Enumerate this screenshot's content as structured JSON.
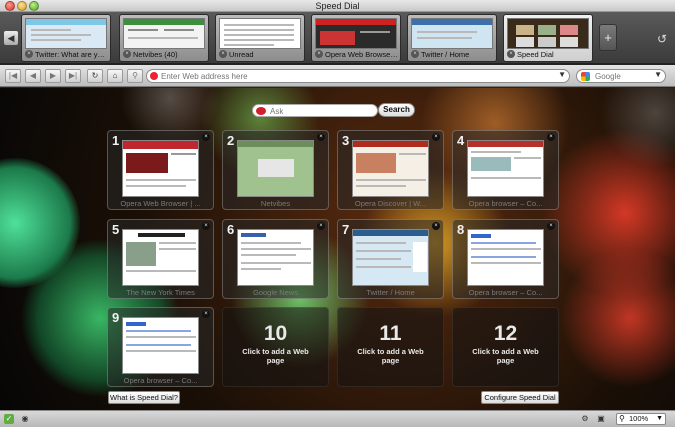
{
  "window": {
    "title": "Speed Dial"
  },
  "tabs": [
    {
      "label": "Twitter: What are you do...",
      "thumb": "#dbe9f4",
      "accent": "#7fc7e6",
      "active": false
    },
    {
      "label": "Netvibes (40)",
      "thumb": "#f3f3f3",
      "accent": "#3d8f3d",
      "active": false
    },
    {
      "label": "Unread",
      "thumb": "#ffffff",
      "accent": "#cccccc",
      "active": false
    },
    {
      "label": "Opera Web Browser | Fa...",
      "thumb": "#2b2b2b",
      "accent": "#cc2222",
      "active": false
    },
    {
      "label": "Twitter / Home",
      "thumb": "#cfe6f2",
      "accent": "#3d6fa8",
      "active": false
    },
    {
      "label": "Speed Dial",
      "thumb": "#3a2a1a",
      "accent": "#e06a20",
      "active": true
    }
  ],
  "toolbar": {
    "address_placeholder": "Enter Web address here",
    "search_placeholder": "Google"
  },
  "speeddial": {
    "ask_placeholder": "Ask",
    "search_button": "Search",
    "what_is_button": "What is Speed Dial?",
    "configure_button": "Configure Speed Dial",
    "dials": [
      {
        "number": "1",
        "label": "Opera Web Browser | ...",
        "thumb": "#ffffff",
        "accent": "#c0262d"
      },
      {
        "number": "2",
        "label": "Netvibes",
        "thumb": "#9fc28f",
        "accent": "#6b8f5a"
      },
      {
        "number": "3",
        "label": "Opera Discover | W...",
        "thumb": "#f5efe6",
        "accent": "#b02a1d"
      },
      {
        "number": "4",
        "label": "Opera browser – Co...",
        "thumb": "#ffffff",
        "accent": "#b53129"
      },
      {
        "number": "5",
        "label": "The New York Times",
        "thumb": "#ffffff",
        "accent": "#222222"
      },
      {
        "number": "6",
        "label": "Google News",
        "thumb": "#ffffff",
        "accent": "#3b5fad"
      },
      {
        "number": "7",
        "label": "Twitter / Home",
        "thumb": "#d6e8f3",
        "accent": "#2c5d8f"
      },
      {
        "number": "8",
        "label": "Opera browser – Co...",
        "thumb": "#ffffff",
        "accent": "#3366cc"
      },
      {
        "number": "9",
        "label": "Opera browser – Co...",
        "thumb": "#ffffff",
        "accent": "#3366cc"
      },
      {
        "number": "10",
        "text": "Click to add a Web page"
      },
      {
        "number": "11",
        "text": "Click to add a Web page"
      },
      {
        "number": "12",
        "text": "Click to add a Web page"
      }
    ]
  },
  "statusbar": {
    "zoom": "100%"
  }
}
